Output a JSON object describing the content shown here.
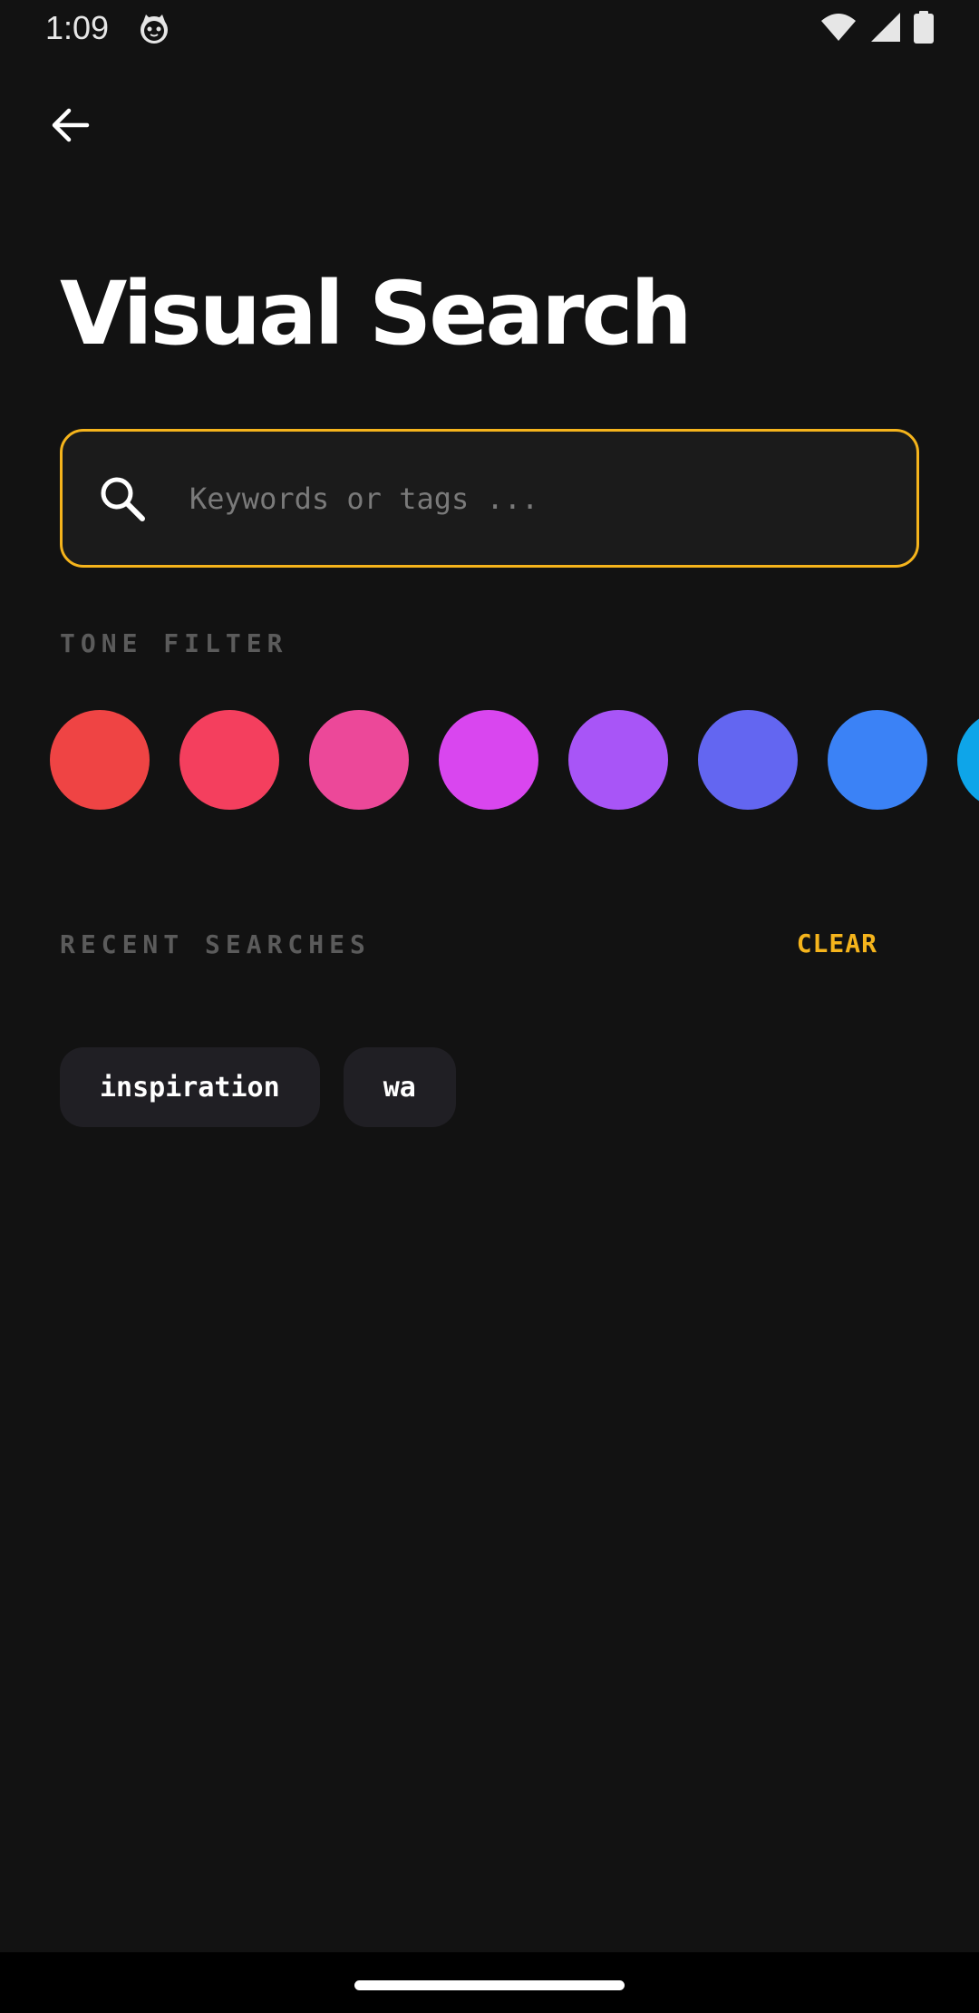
{
  "status_bar": {
    "time": "1:09",
    "app_icon": "cat-face-icon",
    "icons": [
      "wifi-icon",
      "cellular-signal-icon",
      "battery-icon"
    ]
  },
  "header": {
    "back_icon": "arrow-left-icon",
    "title": "Visual Search"
  },
  "search": {
    "icon": "search-icon",
    "placeholder": "Keywords or tags ...",
    "value": "",
    "border_color": "#f5b41c"
  },
  "tone_filter": {
    "label": "TONE FILTER",
    "swatches": [
      {
        "color": "#ef4444"
      },
      {
        "color": "#f43f5e"
      },
      {
        "color": "#ec4899"
      },
      {
        "color": "#d946ef"
      },
      {
        "color": "#a855f7"
      },
      {
        "color": "#6366f1"
      },
      {
        "color": "#3b82f6"
      },
      {
        "color": "#0ea5e9"
      }
    ]
  },
  "recent_searches": {
    "label": "RECENT SEARCHES",
    "clear_label": "CLEAR",
    "items": [
      {
        "label": "inspiration"
      },
      {
        "label": "wa"
      }
    ]
  },
  "colors": {
    "background": "#121212",
    "accent": "#f5b41c",
    "chip": "#201f24",
    "muted_label": "#5b5b5b"
  }
}
